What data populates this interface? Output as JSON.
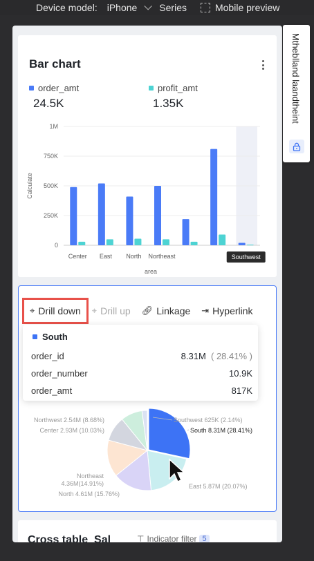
{
  "topbar": {
    "device_model_label": "Device model:",
    "device": "iPhone",
    "series": "Series",
    "mobile_preview": "Mobile preview"
  },
  "side_panel": {
    "text": "Mtheblland laandtheint"
  },
  "bar_card": {
    "title": "Bar chart",
    "legend": [
      {
        "name": "order_amt",
        "value": "24.5K",
        "color": "#4a7bf7"
      },
      {
        "name": "profit_amt",
        "value": "1.35K",
        "color": "#4dd3d3"
      }
    ]
  },
  "chart_data": {
    "type": "bar",
    "categories": [
      "Center",
      "East",
      "North",
      "Northeast",
      "",
      "Southwest"
    ],
    "series": [
      {
        "name": "order_amt",
        "values": [
          490000,
          520000,
          410000,
          500000,
          220000,
          810000,
          20000
        ]
      },
      {
        "name": "profit_amt",
        "values": [
          30000,
          50000,
          55000,
          50000,
          30000,
          90000,
          5000
        ]
      }
    ],
    "category_labels_shown": [
      "Center",
      "East",
      "North",
      "Northeast",
      "",
      "",
      "Southwest"
    ],
    "ylabel": "Calculate",
    "xlabel": "area",
    "yticks": [
      "0",
      "250K",
      "500K",
      "750K",
      "1M"
    ],
    "ylim": [
      0,
      1000000
    ],
    "highlighted_category": "Southwest"
  },
  "pie_card": {
    "toolbar": {
      "drill_down": "Drill down",
      "drill_up": "Drill up",
      "linkage": "Linkage",
      "hyperlink": "Hyperlink"
    },
    "tooltip": {
      "title": "South",
      "rows": [
        {
          "label": "order_id",
          "value": "8.31M",
          "pct": "( 28.41% )"
        },
        {
          "label": "order_number",
          "value": "10.9K",
          "pct": ""
        },
        {
          "label": "order_amt",
          "value": "817K",
          "pct": ""
        }
      ]
    },
    "slices": [
      {
        "label": "South 8.31M (28.41%)",
        "value": 28.41,
        "color": "#3d73f5"
      },
      {
        "label": "East 5.87M (20.07%)",
        "value": 20.07,
        "color": "#c9eef0"
      },
      {
        "label": "North 4.61M (15.76%)",
        "value": 15.76,
        "color": "#d9d4f7"
      },
      {
        "label": "Northeast 4.36M(14.91%)",
        "value": 14.91,
        "color": "#fde5d2"
      },
      {
        "label": "Center 2.93M (10.03%)",
        "value": 10.03,
        "color": "#d3d6df"
      },
      {
        "label": "Northwest 2.54M (8.68%)",
        "value": 8.68,
        "color": "#cdeedd"
      },
      {
        "label": "Southwest 625K (2.14%)",
        "value": 2.14,
        "color": "#dbe2f3"
      }
    ]
  },
  "cross_card": {
    "title": "Cross table_Sal",
    "filter": "Indicator filter",
    "badge": "5"
  }
}
